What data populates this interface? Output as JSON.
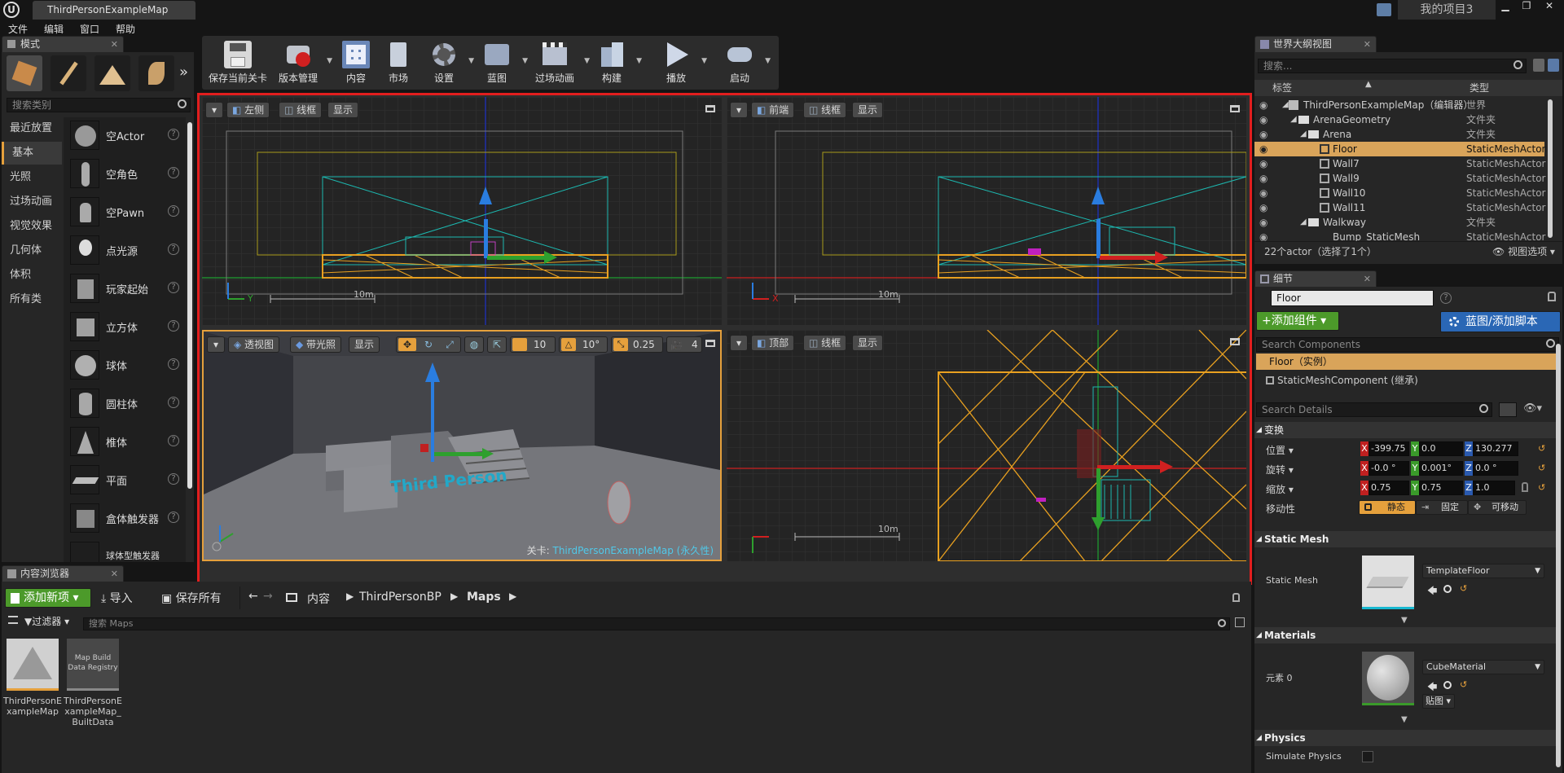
{
  "titlebar": {
    "tab_title": "ThirdPersonExampleMap",
    "project_name": "我的项目3"
  },
  "menu": [
    "文件",
    "编辑",
    "窗口",
    "帮助"
  ],
  "modes_panel": {
    "tab": "模式",
    "search_placeholder": "搜索类别",
    "categories": [
      "最近放置",
      "基本",
      "光照",
      "过场动画",
      "视觉效果",
      "几何体",
      "体积",
      "所有类"
    ],
    "selected_category": "基本",
    "items": [
      "空Actor",
      "空角色",
      "空Pawn",
      "点光源",
      "玩家起始",
      "立方体",
      "球体",
      "圆柱体",
      "椎体",
      "平面",
      "盒体触发器",
      "球体型触发器"
    ]
  },
  "toolbar": {
    "buttons": [
      "保存当前关卡",
      "版本管理",
      "内容",
      "市场",
      "设置",
      "蓝图",
      "过场动画",
      "构建",
      "播放",
      "启动"
    ]
  },
  "viewports": {
    "left": {
      "view": "左侧",
      "mode": "线框",
      "show": "显示",
      "scale": "10m"
    },
    "front": {
      "view": "前端",
      "mode": "线框",
      "show": "显示",
      "scale": "10m"
    },
    "persp": {
      "view": "透视图",
      "mode": "带光照",
      "show": "显示",
      "grid": "10",
      "rot": "10°",
      "scale": "0.25",
      "speed": "4",
      "level_label": "关卡:",
      "level_name": "ThirdPersonExampleMap (永久性)"
    },
    "top": {
      "view": "顶部",
      "mode": "线框",
      "show": "显示",
      "scale": "10m"
    }
  },
  "outliner": {
    "tab": "世界大纲视图",
    "search_placeholder": "搜索...",
    "col_label": "标签",
    "col_type": "类型",
    "rows": [
      {
        "label": "ThirdPersonExampleMap（编辑器）",
        "type": "世界"
      },
      {
        "label": "ArenaGeometry",
        "type": "文件夹"
      },
      {
        "label": "Arena",
        "type": "文件夹"
      },
      {
        "label": "Floor",
        "type": "StaticMeshActor"
      },
      {
        "label": "Wall7",
        "type": "StaticMeshActor"
      },
      {
        "label": "Wall9",
        "type": "StaticMeshActor"
      },
      {
        "label": "Wall10",
        "type": "StaticMeshActor"
      },
      {
        "label": "Wall11",
        "type": "StaticMeshActor"
      },
      {
        "label": "Walkway",
        "type": "文件夹"
      },
      {
        "label": "Bump_StaticMesh",
        "type": "StaticMeshActor"
      }
    ],
    "status": "22个actor（选择了1个）",
    "view_options": "视图选项"
  },
  "details": {
    "tab": "细节",
    "name": "Floor",
    "add_component": "+添加组件",
    "blueprint": "蓝图/添加脚本",
    "search_components_placeholder": "Search Components",
    "component_root": "Floor（实例）",
    "component_child": "StaticMeshComponent (继承)",
    "search_details_placeholder": "Search Details",
    "transform_header": "变换",
    "location_label": "位置",
    "rotation_label": "旋转",
    "scale_label": "缩放",
    "mobility_label": "移动性",
    "location": [
      "-399.75",
      "0.0",
      "130.277"
    ],
    "rotation": [
      "-0.0 °",
      "0.001°",
      "0.0 °"
    ],
    "scale": [
      "0.75",
      "0.75",
      "1.0"
    ],
    "mobility_options": [
      "静态",
      "固定",
      "可移动"
    ],
    "static_mesh_header": "Static Mesh",
    "static_mesh_label": "Static Mesh",
    "static_mesh_value": "TemplateFloor",
    "materials_header": "Materials",
    "element_label": "元素 0",
    "material_value": "CubeMaterial",
    "texture_btn": "贴图",
    "physics_header": "Physics",
    "simulate_physics": "Simulate Physics"
  },
  "content_browser": {
    "tab": "内容浏览器",
    "add_new": "添加新项",
    "import": "导入",
    "save_all": "保存所有",
    "breadcrumb": [
      "内容",
      "ThirdPersonBP",
      "Maps"
    ],
    "filter": "过滤器",
    "search_placeholder": "搜索 Maps",
    "assets": [
      {
        "name": "ThirdPersonExampleMap",
        "thumb_text": ""
      },
      {
        "name": "ThirdPersonExampleMap_BuiltData",
        "thumb_text": "Map Build Data Registry"
      }
    ]
  },
  "colors": {
    "accent_orange": "#e5a03c",
    "selection_red": "#e21e1e",
    "add_green": "#4c9a2a",
    "blueprint_blue": "#2a67b5"
  }
}
